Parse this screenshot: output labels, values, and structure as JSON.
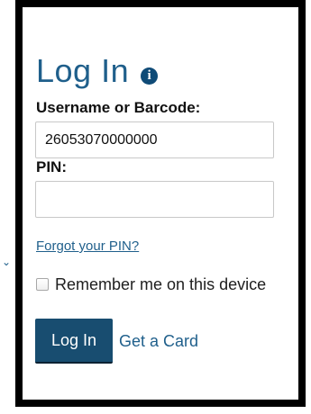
{
  "login_form": {
    "title": "Log In",
    "info_icon_glyph": "i",
    "username_label": "Username or Barcode:",
    "username_value": "26053070000000",
    "pin_label": "PIN:",
    "pin_value": "",
    "forgot_pin_link": "Forgot your PIN?",
    "remember_label": "Remember me on this device",
    "login_button": "Log In",
    "get_card_link": "Get a Card"
  },
  "icons": {
    "info": "info-icon",
    "remember_checkbox": "checkbox-icon"
  },
  "colors": {
    "accent": "#1f5f8b",
    "button": "#184d70",
    "border": "#000000"
  }
}
